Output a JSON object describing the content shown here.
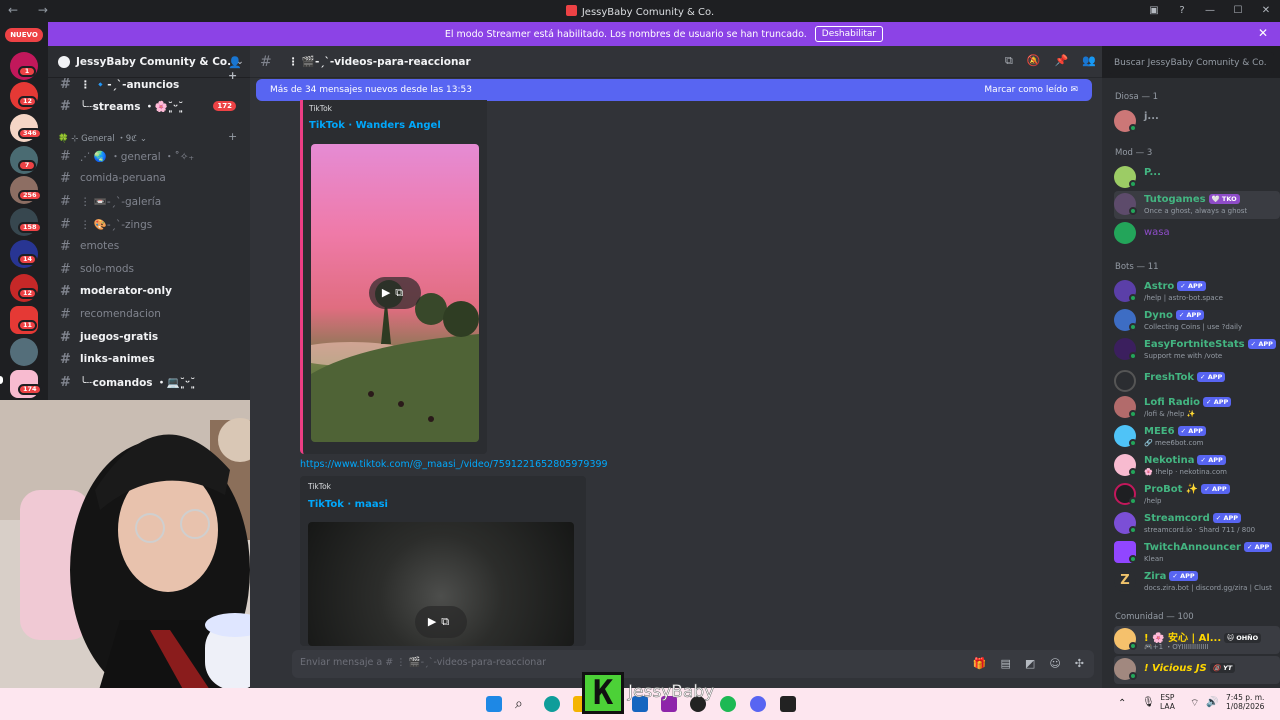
{
  "window": {
    "title": "JessyBaby Comunity & Co.",
    "nav_back": "←",
    "nav_forward": "→"
  },
  "banner": {
    "text": "El modo Streamer está habilitado. Los nombres de usuario se han truncado.",
    "button": "Deshabilitar"
  },
  "guilds": {
    "new_badge": "NUEVO",
    "badges": [
      "1",
      "12",
      "346",
      "7",
      "256",
      "158",
      "14",
      "12",
      "11",
      "174"
    ]
  },
  "server": {
    "name": "JessyBaby Comunity & Co.",
    "channels_top": [
      {
        "label": "⋮ 🔹-ˏˋ-anuncios",
        "bold": true
      },
      {
        "label": "╰┈streams ・🌸˘͈ᵕ˘͈",
        "bold": true,
        "badge": "172"
      }
    ],
    "category": "🍀 ⊹ General ・9ℭ ⌄",
    "channels": [
      {
        "label": "⋰ 🌏 ・general ・˚✧₊",
        "bold": false
      },
      {
        "label": "comida-peruana",
        "bold": false
      },
      {
        "label": "⋮ 📼-ˏˋ-galería",
        "bold": false
      },
      {
        "label": "⋮ 🎨-ˏˋ-zings",
        "bold": false
      },
      {
        "label": "emotes",
        "bold": false
      },
      {
        "label": "solo-mods",
        "bold": false
      },
      {
        "label": "moderator-only",
        "bold": true
      },
      {
        "label": "recomendacion",
        "bold": false
      },
      {
        "label": "juegos-gratis",
        "bold": true
      },
      {
        "label": "links-animes",
        "bold": true
      },
      {
        "label": "╰┈comandos ・💻˘͈ᵕ˘͈",
        "bold": true
      }
    ]
  },
  "chat": {
    "channel_name": "⋮ 🎬-ˏˋ-videos-para-reaccionar",
    "search_placeholder": "Buscar JessyBaby Comunity & Co.",
    "new_messages": "Más de 34 mensajes nuevos desde las 13:53",
    "mark_read": "Marcar como leído",
    "embed1": {
      "provider": "TikTok",
      "title": "TikTok · Wanders Angel"
    },
    "link": "https://www.tiktok.com/@_maasi_/video/7591221652805979399",
    "embed2": {
      "provider": "TikTok",
      "title": "TikTok · maasi"
    },
    "composer_placeholder": "Enviar mensaje a # ⋮ 🎬-ˏˋ-videos-para-reaccionar"
  },
  "members": {
    "groups": [
      {
        "label": "Diosa — 1"
      },
      {
        "label": "Mod — 3"
      },
      {
        "label": "Bots — 11"
      },
      {
        "label": "Comunidad — 100"
      }
    ],
    "list": [
      {
        "name": "j...",
        "status": "",
        "color": "#949ba4",
        "app": false,
        "tag": ""
      },
      {
        "name": "P...",
        "status": "",
        "color": "#43b581",
        "app": false,
        "tag": ""
      },
      {
        "name": "Tutogames",
        "status": "Once a ghost, always a ghost",
        "color": "#43b581",
        "app": false,
        "tag": "🤍 TKO"
      },
      {
        "name": "wasa",
        "status": "",
        "color": "#8e4cc8",
        "app": false,
        "tag": ""
      },
      {
        "name": "Astro",
        "status": "/help | astro-bot.space",
        "color": "#43b581",
        "app": true,
        "tag": "✓ APP"
      },
      {
        "name": "Dyno",
        "status": "Collecting Coins | use ?daily",
        "color": "#43b581",
        "app": true,
        "tag": "✓ APP"
      },
      {
        "name": "EasyFortniteStats",
        "status": "Support me with /vote",
        "color": "#43b581",
        "app": true,
        "tag": "✓ APP"
      },
      {
        "name": "FreshTok",
        "status": "",
        "color": "#43b581",
        "app": true,
        "tag": "✓ APP"
      },
      {
        "name": "Lofi Radio",
        "status": "/lofi & /help ✨",
        "color": "#43b581",
        "app": true,
        "tag": "✓ APP"
      },
      {
        "name": "MEE6",
        "status": "🔗 mee6bot.com",
        "color": "#43b581",
        "app": true,
        "tag": "✓ APP"
      },
      {
        "name": "Nekotina",
        "status": "🌸 !help · nekotina.com",
        "color": "#43b581",
        "app": true,
        "tag": "✓ APP"
      },
      {
        "name": "ProBot ✨",
        "status": "/help",
        "color": "#43b581",
        "app": true,
        "tag": "✓ APP"
      },
      {
        "name": "Streamcord",
        "status": "streamcord.io · Shard 711 / 800",
        "color": "#43b581",
        "app": true,
        "tag": "✓ APP"
      },
      {
        "name": "TwitchAnnouncer",
        "status": "Klean",
        "color": "#43b581",
        "app": true,
        "tag": "✓ APP"
      },
      {
        "name": "Zira",
        "status": "docs.zira.bot | discord.gg/zira | Clust",
        "color": "#43b581",
        "app": true,
        "tag": "✓ APP"
      },
      {
        "name": "! 🌸 安心 | Al...",
        "status": "🎮+1 ・OYIIIIIIIIIIIII",
        "color": "#ffd700",
        "app": false,
        "tag": "🐱 OHÑO"
      },
      {
        "name": "! Vicious JS",
        "status": "",
        "color": "#ffd700",
        "app": false,
        "tag": "🔞 YT"
      }
    ]
  },
  "overlay": {
    "letter": "K",
    "name": "JessyBaby"
  },
  "taskbar": {
    "lang": "ESP",
    "region": "LAA",
    "time": "7:45 p. m.",
    "date": "1/08/2026"
  },
  "colors": {
    "blurple": "#5865f2",
    "streamer": "#8c43e6",
    "link": "#00a8fc",
    "mention": "#ed4245"
  }
}
